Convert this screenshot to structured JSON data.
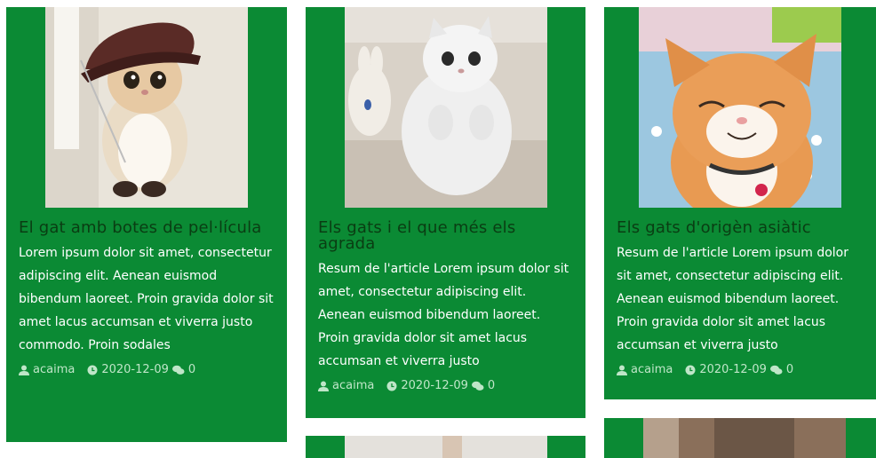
{
  "cards": [
    {
      "title": "El gat amb botes de pel·lícula",
      "excerpt": "Lorem ipsum dolor sit amet, consectetur adipiscing elit. Aenean euismod bibendum laoreet. Proin gravida dolor sit amet lacus accumsan et viverra justo commodo. Proin sodales",
      "author": "acaima",
      "date": "2020-12-09",
      "comments": "0"
    },
    {
      "title": "Els gats i el que més els agrada",
      "excerpt": "Resum de l'article Lorem ipsum dolor sit amet, consectetur adipiscing elit. Aenean euismod bibendum laoreet. Proin gravida dolor sit amet lacus accumsan et viverra justo",
      "author": "acaima",
      "date": "2020-12-09",
      "comments": "0"
    },
    {
      "title": "Els gats d'origèn asiàtic",
      "excerpt": "Resum de l'article Lorem ipsum dolor sit amet, consectetur adipiscing elit. Aenean euismod bibendum laoreet. Proin gravida dolor sit amet lacus accumsan et viverra justo",
      "author": "acaima",
      "date": "2020-12-09",
      "comments": "0"
    }
  ],
  "icons": {
    "author": "user-icon",
    "date": "clock-icon",
    "comments": "comments-icon"
  },
  "colors": {
    "card_bg": "#0b8a34",
    "title": "#0a3d13",
    "meta": "#bfe6c8"
  }
}
